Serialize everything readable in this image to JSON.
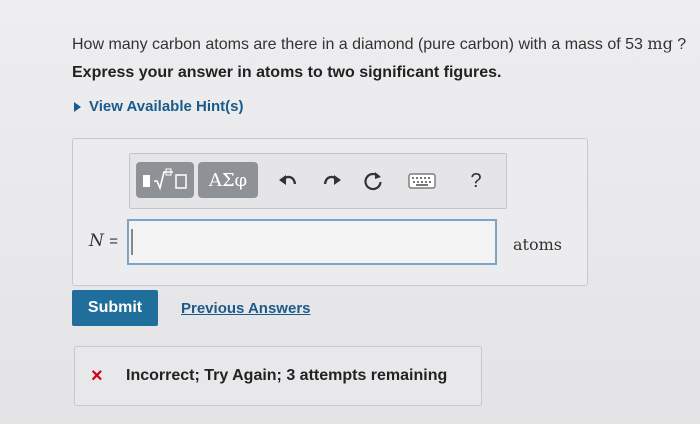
{
  "question": {
    "text_before": "How many carbon atoms are there in a diamond (pure carbon) with a mass of 53 ",
    "unit": "mg",
    "text_after": " ?",
    "instruction": "Express your answer in atoms to two significant figures."
  },
  "hints": {
    "label": "View Available Hint(s)"
  },
  "toolbar": {
    "greek_label": "ΑΣφ",
    "help_label": "?"
  },
  "answer": {
    "variable": "N",
    "equals": "=",
    "value": "",
    "units": "atoms"
  },
  "actions": {
    "submit_label": "Submit",
    "previous_label": "Previous Answers"
  },
  "feedback": {
    "icon": "×",
    "message": "Incorrect; Try Again; 3 attempts remaining",
    "status_color": "#d0021b"
  }
}
